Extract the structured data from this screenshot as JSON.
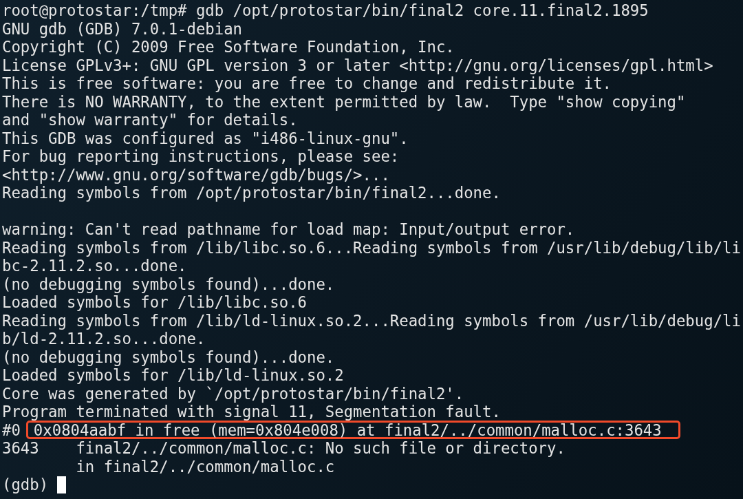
{
  "terminal": {
    "lines": [
      {
        "kind": "text",
        "text": "root@protostar:/tmp# gdb /opt/protostar/bin/final2 core.11.final2.1895"
      },
      {
        "kind": "text",
        "text": "GNU gdb (GDB) 7.0.1-debian"
      },
      {
        "kind": "text",
        "text": "Copyright (C) 2009 Free Software Foundation, Inc."
      },
      {
        "kind": "text",
        "text": "License GPLv3+: GNU GPL version 3 or later <http://gnu.org/licenses/gpl.html>"
      },
      {
        "kind": "text",
        "text": "This is free software: you are free to change and redistribute it."
      },
      {
        "kind": "text",
        "text": "There is NO WARRANTY, to the extent permitted by law.  Type \"show copying\""
      },
      {
        "kind": "text",
        "text": "and \"show warranty\" for details."
      },
      {
        "kind": "text",
        "text": "This GDB was configured as \"i486-linux-gnu\"."
      },
      {
        "kind": "text",
        "text": "For bug reporting instructions, please see:"
      },
      {
        "kind": "text",
        "text": "<http://www.gnu.org/software/gdb/bugs/>..."
      },
      {
        "kind": "text",
        "text": "Reading symbols from /opt/protostar/bin/final2...done."
      },
      {
        "kind": "blank"
      },
      {
        "kind": "text",
        "text": "warning: Can't read pathname for load map: Input/output error."
      },
      {
        "kind": "text",
        "text": "Reading symbols from /lib/libc.so.6...Reading symbols from /usr/lib/debug/lib/li"
      },
      {
        "kind": "text",
        "text": "bc-2.11.2.so...done."
      },
      {
        "kind": "text",
        "text": "(no debugging symbols found)...done."
      },
      {
        "kind": "text",
        "text": "Loaded symbols for /lib/libc.so.6"
      },
      {
        "kind": "text",
        "text": "Reading symbols from /lib/ld-linux.so.2...Reading symbols from /usr/lib/debug/li"
      },
      {
        "kind": "text",
        "text": "b/ld-2.11.2.so...done."
      },
      {
        "kind": "text",
        "text": "(no debugging symbols found)...done."
      },
      {
        "kind": "text",
        "text": "Loaded symbols for /lib/ld-linux.so.2"
      },
      {
        "kind": "text",
        "text": "Core was generated by `/opt/protostar/bin/final2'."
      },
      {
        "kind": "text",
        "text": "Program terminated with signal 11, Segmentation fault."
      },
      {
        "kind": "frame",
        "prefix": "#0",
        "text": "0x0804aabf in free (mem=0x804e008) at final2/../common/malloc.c:3643",
        "highlighted": true
      },
      {
        "kind": "text",
        "text": "3643    final2/../common/malloc.c: No such file or directory."
      },
      {
        "kind": "text",
        "text": "        in final2/../common/malloc.c"
      },
      {
        "kind": "prompt",
        "text": "(gdb)",
        "cursor": true
      }
    ]
  }
}
